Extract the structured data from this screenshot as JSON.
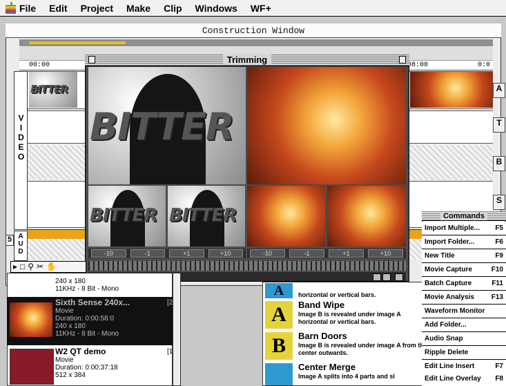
{
  "menubar": {
    "items": [
      "File",
      "Edit",
      "Project",
      "Make",
      "Clip",
      "Windows",
      "WF+"
    ]
  },
  "construction": {
    "title": "Construction Window",
    "ruler_left": "00:00",
    "ruler_right": "08:00",
    "ruler_far": "0:0",
    "track_video": "VIDEO",
    "track_audio": "AUD",
    "side_letters": [
      "A",
      "T",
      "B",
      "S"
    ],
    "track_number": "5"
  },
  "trimming": {
    "title": "Trimming",
    "frame_word": "BITTER",
    "controls_left": [
      "-10",
      "-1",
      "+1",
      "+10"
    ],
    "controls_right": [
      "-10",
      "-1",
      "+1",
      "+10"
    ]
  },
  "bin": {
    "items": [
      {
        "name": "",
        "lines": [
          "240 x 180",
          "11KHz - 8 Bit - Mono"
        ],
        "num": ""
      },
      {
        "name": "Sixth Sense 240x...",
        "lines": [
          "Movie",
          "Duration: 0:00:58:0",
          "240 x 180",
          "11KHz - 8 Bit - Mono"
        ],
        "num": "[2]"
      },
      {
        "name": "W2 QT demo",
        "lines": [
          "Movie",
          "Duration:   0:00:37:18",
          "512 x 384"
        ],
        "num": "[1]"
      }
    ]
  },
  "transitions": {
    "items": [
      {
        "icon": "A",
        "title": "",
        "desc": "horizontal or vertical bars."
      },
      {
        "icon": "A",
        "title": "Band Wipe",
        "desc": "Image B is revealed under image A horizontal or vertical bars."
      },
      {
        "icon": "B",
        "title": "Barn Doors",
        "desc": "Image B is revealed under image A from the center outwards."
      },
      {
        "icon": "",
        "title": "Center Merge",
        "desc": "Image A splits into 4 parts and sl"
      }
    ]
  },
  "commands": {
    "title": "Commands",
    "items": [
      {
        "label": "Import Multiple...",
        "key": "F5"
      },
      {
        "label": "Import Folder...",
        "key": "F6"
      },
      {
        "label": "New Title",
        "key": "F9"
      },
      {
        "label": "Movie Capture",
        "key": "F10"
      },
      {
        "label": "Batch Capture",
        "key": "F11"
      },
      {
        "label": "Movie Analysis",
        "key": "F13"
      },
      {
        "label": "Waveform Monitor",
        "key": ""
      },
      {
        "label": "Add Folder...",
        "key": ""
      },
      {
        "label": "Audio Snap",
        "key": ""
      },
      {
        "label": "Ripple Delete",
        "key": ""
      },
      {
        "label": "Edit Line Insert",
        "key": "F7"
      },
      {
        "label": "Edit Line Overlay",
        "key": "F8"
      }
    ]
  },
  "colors": {
    "timeline_bar": "#e7c11a",
    "transition_icon_blue": "#2c9ad0",
    "transition_icon_yellow": "#e4d33c"
  }
}
